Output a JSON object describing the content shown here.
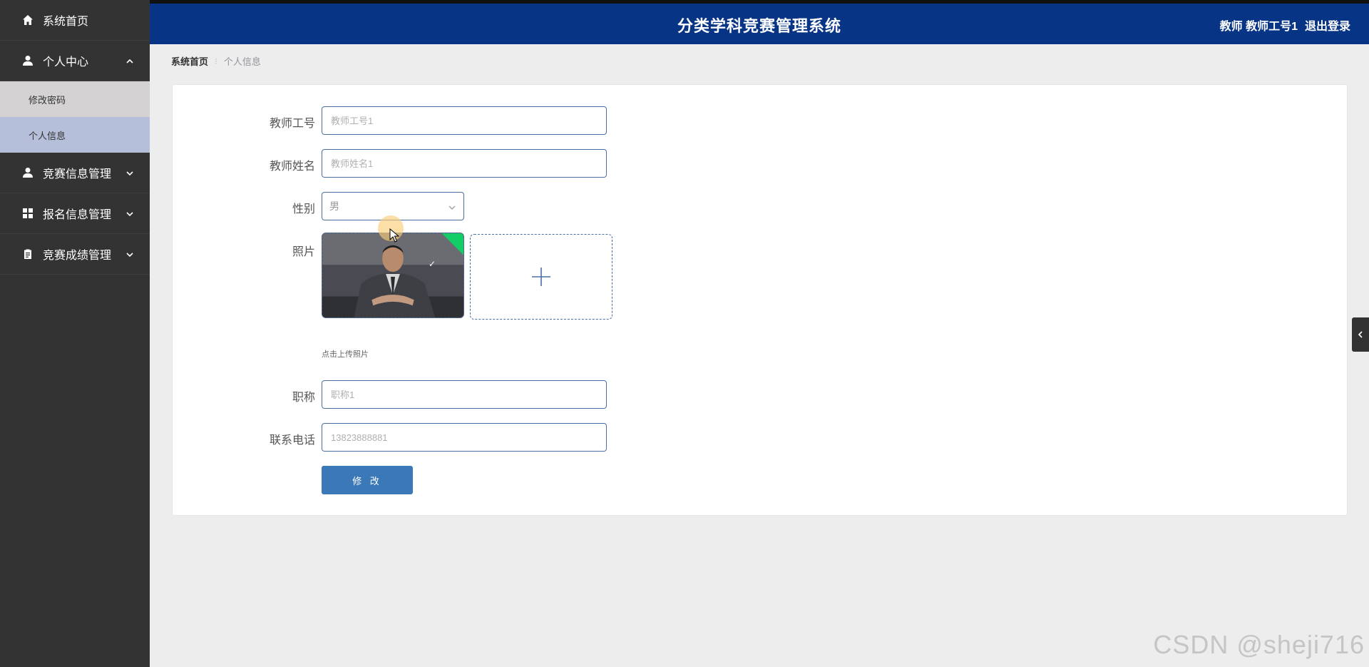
{
  "sidebar": {
    "items": [
      {
        "label": "系统首页",
        "icon": "home-icon"
      },
      {
        "label": "个人中心",
        "icon": "user-icon",
        "expanded": true,
        "children": [
          {
            "label": "修改密码"
          },
          {
            "label": "个人信息"
          }
        ]
      },
      {
        "label": "竞赛信息管理",
        "icon": "user-icon"
      },
      {
        "label": "报名信息管理",
        "icon": "grid-icon"
      },
      {
        "label": "竞赛成绩管理",
        "icon": "clipboard-icon"
      }
    ]
  },
  "header": {
    "title": "分类学科竞赛管理系统",
    "user_label": "教师 教师工号1",
    "logout_label": "退出登录",
    "bg_color": "#073485"
  },
  "breadcrumb": {
    "home": "系统首页",
    "separator": "⁝",
    "current": "个人信息"
  },
  "form": {
    "teacher_id": {
      "label": "教师工号",
      "placeholder": "教师工号1"
    },
    "teacher_name": {
      "label": "教师姓名",
      "placeholder": "教师姓名1"
    },
    "gender": {
      "label": "性别",
      "value": "男"
    },
    "photo": {
      "label": "照片",
      "tip": "点击上传照片"
    },
    "title": {
      "label": "职称",
      "placeholder": "职称1"
    },
    "phone": {
      "label": "联系电话",
      "placeholder": "13823888881"
    },
    "submit_label": "修 改"
  },
  "watermark": "CSDN @sheji716",
  "colors": {
    "sidebar_bg": "#333333",
    "submenu_active": "#b5bfda",
    "button": "#3a78b8",
    "upload_success": "#13ce66"
  }
}
